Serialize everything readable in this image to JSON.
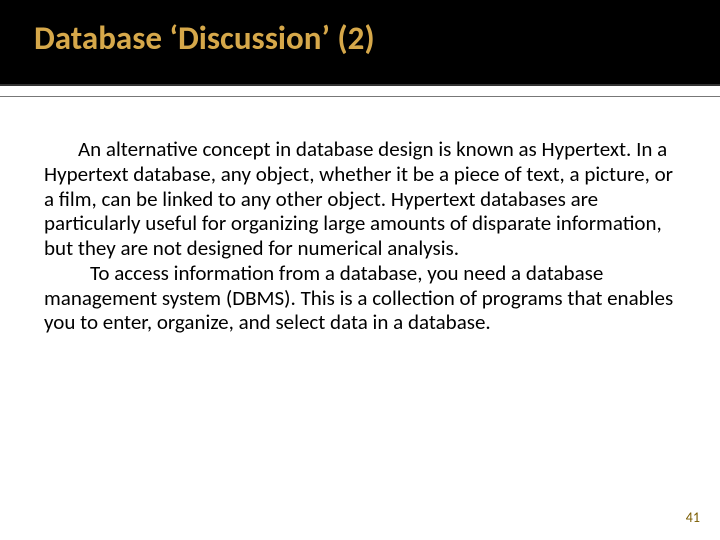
{
  "title": "Database ‘Discussion’ (2)",
  "body": {
    "p1": "An alternative concept in database design is known as Hypertext. In a Hypertext database, any object, whether it be a piece of text, a picture, or a film, can be linked to any other object. Hypertext databases are particularly useful for organizing large amounts of disparate information, but they are not designed for numerical analysis.",
    "p2": "To access information from a database, you need a database management system (DBMS). This is a collection of programs that enables you to enter, organize, and select data in a database."
  },
  "page_number": "41"
}
